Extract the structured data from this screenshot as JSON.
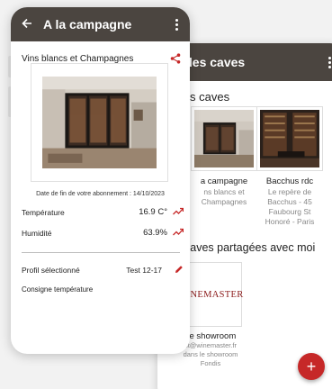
{
  "back_screen": {
    "title": "de des caves",
    "section_my_caves": "s caves",
    "caves": [
      {
        "name": "a campagne",
        "sub": "ns blancs et Champagnes"
      },
      {
        "name": "Bacchus rdc",
        "sub": "Le repère de Bacchus - 45 Faubourg St Honoré - Paris"
      }
    ],
    "section_shared": "caves partagées avec moi",
    "shared": [
      {
        "logo_text": "WINEMASTER",
        "name": "ve showroom",
        "sub": "st@winemaster.fr dans le showroom Fondis"
      }
    ],
    "fab_label": "+"
  },
  "front_screen": {
    "title": "A la campagne",
    "back_icon": "arrow-left",
    "subtitle": "Vins blancs et Champagnes",
    "abonnement": "Date de fin de votre abonnement : 14/10/2023",
    "temperature_label": "Température",
    "temperature_value": "16.9 C°",
    "humidity_label": "Humidité",
    "humidity_value": "63.9%",
    "profile_label": "Profil sélectionné",
    "profile_value": "Test 12-17",
    "consigne_label": "Consigne température"
  },
  "colors": {
    "header": "#4b4540",
    "accent": "#c62828",
    "background": "#f2f2f2"
  }
}
